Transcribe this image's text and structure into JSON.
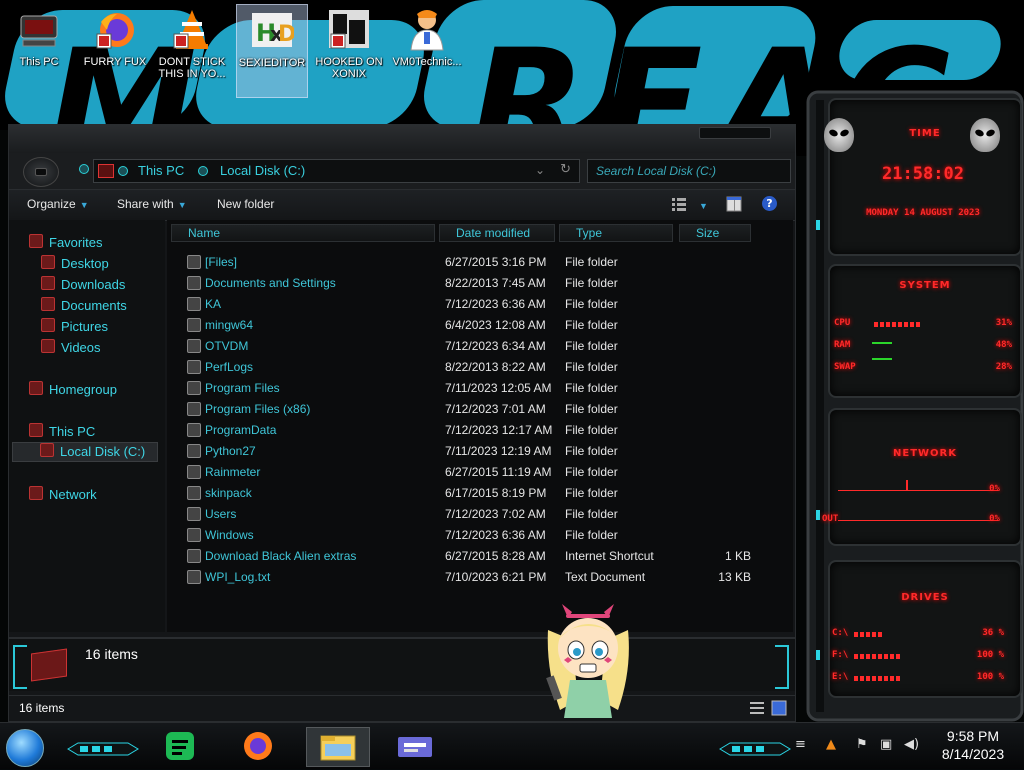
{
  "desktop": {
    "icons": [
      {
        "label": "This PC",
        "icon": "this-pc-icon"
      },
      {
        "label": "FURRY FUX",
        "icon": "firefox-icon"
      },
      {
        "label": "DONT STICK THIS IN YO...",
        "icon": "vlc-icon"
      },
      {
        "label": "SEXIEDITOR",
        "icon": "hxd-editor-icon"
      },
      {
        "label": "HOOKED ON XONIX",
        "icon": "xonix-icon"
      },
      {
        "label": "VM0Technic...",
        "icon": "doctor-icon"
      }
    ]
  },
  "explorer": {
    "breadcrumb": [
      "This PC",
      "Local Disk (C:)"
    ],
    "search_placeholder": "Search Local Disk (C:)",
    "commands": {
      "organize": "Organize",
      "share_with": "Share with",
      "new_folder": "New folder"
    },
    "nav": {
      "favorites": "Favorites",
      "favorites_items": [
        "Desktop",
        "Downloads",
        "Documents",
        "Pictures",
        "Videos"
      ],
      "homegroup": "Homegroup",
      "this_pc": "This PC",
      "local_disk": "Local Disk (C:)",
      "network": "Network"
    },
    "columns": {
      "name": "Name",
      "date": "Date modified",
      "type": "Type",
      "size": "Size"
    },
    "files": [
      {
        "name": "[Files]",
        "date": "6/27/2015 3:16 PM",
        "type": "File folder",
        "size": ""
      },
      {
        "name": "Documents and Settings",
        "date": "8/22/2013 7:45 AM",
        "type": "File folder",
        "size": ""
      },
      {
        "name": "KA",
        "date": "7/12/2023 6:36 AM",
        "type": "File folder",
        "size": ""
      },
      {
        "name": "mingw64",
        "date": "6/4/2023 12:08 AM",
        "type": "File folder",
        "size": ""
      },
      {
        "name": "OTVDM",
        "date": "7/12/2023 6:34 AM",
        "type": "File folder",
        "size": ""
      },
      {
        "name": "PerfLogs",
        "date": "8/22/2013 8:22 AM",
        "type": "File folder",
        "size": ""
      },
      {
        "name": "Program Files",
        "date": "7/11/2023 12:05 AM",
        "type": "File folder",
        "size": ""
      },
      {
        "name": "Program Files (x86)",
        "date": "7/12/2023 7:01 AM",
        "type": "File folder",
        "size": ""
      },
      {
        "name": "ProgramData",
        "date": "7/12/2023 12:17 AM",
        "type": "File folder",
        "size": ""
      },
      {
        "name": "Python27",
        "date": "7/11/2023 12:19 AM",
        "type": "File folder",
        "size": ""
      },
      {
        "name": "Rainmeter",
        "date": "6/27/2015 11:19 AM",
        "type": "File folder",
        "size": ""
      },
      {
        "name": "skinpack",
        "date": "6/17/2015 8:19 PM",
        "type": "File folder",
        "size": ""
      },
      {
        "name": "Users",
        "date": "7/12/2023 7:02 AM",
        "type": "File folder",
        "size": ""
      },
      {
        "name": "Windows",
        "date": "7/12/2023 6:36 AM",
        "type": "File folder",
        "size": ""
      },
      {
        "name": "Download Black Alien extras",
        "date": "6/27/2015 8:28 AM",
        "type": "Internet Shortcut",
        "size": "1 KB"
      },
      {
        "name": "WPI_Log.txt",
        "date": "7/10/2023 6:21 PM",
        "type": "Text Document",
        "size": "13 KB"
      }
    ],
    "details_text": "16 items",
    "status_text": "16 items"
  },
  "gadget": {
    "time_title": "TIME",
    "time": "21:58:02",
    "date": "MONDAY 14 AUGUST 2023",
    "system_title": "SYSTEM",
    "system": [
      {
        "label": "CPU",
        "value": "31%"
      },
      {
        "label": "RAM",
        "value": "48%"
      },
      {
        "label": "SWAP",
        "value": "28%"
      }
    ],
    "network_title": "NETWORK",
    "network": [
      {
        "label": "IN",
        "value": "0%"
      },
      {
        "label": "OUT",
        "value": "0%"
      }
    ],
    "drives_title": "DRIVES",
    "drives": [
      {
        "label": "C:\\",
        "value": "36 %"
      },
      {
        "label": "F:\\",
        "value": "100 %"
      },
      {
        "label": "E:\\",
        "value": "100 %"
      }
    ],
    "accent": "#ff2a2a"
  },
  "taskbar": {
    "apps": [
      "spotify-icon",
      "firefox-icon",
      "explorer-icon",
      "media-player-icon"
    ],
    "clock_time": "9:58 PM",
    "clock_date": "8/14/2023"
  }
}
